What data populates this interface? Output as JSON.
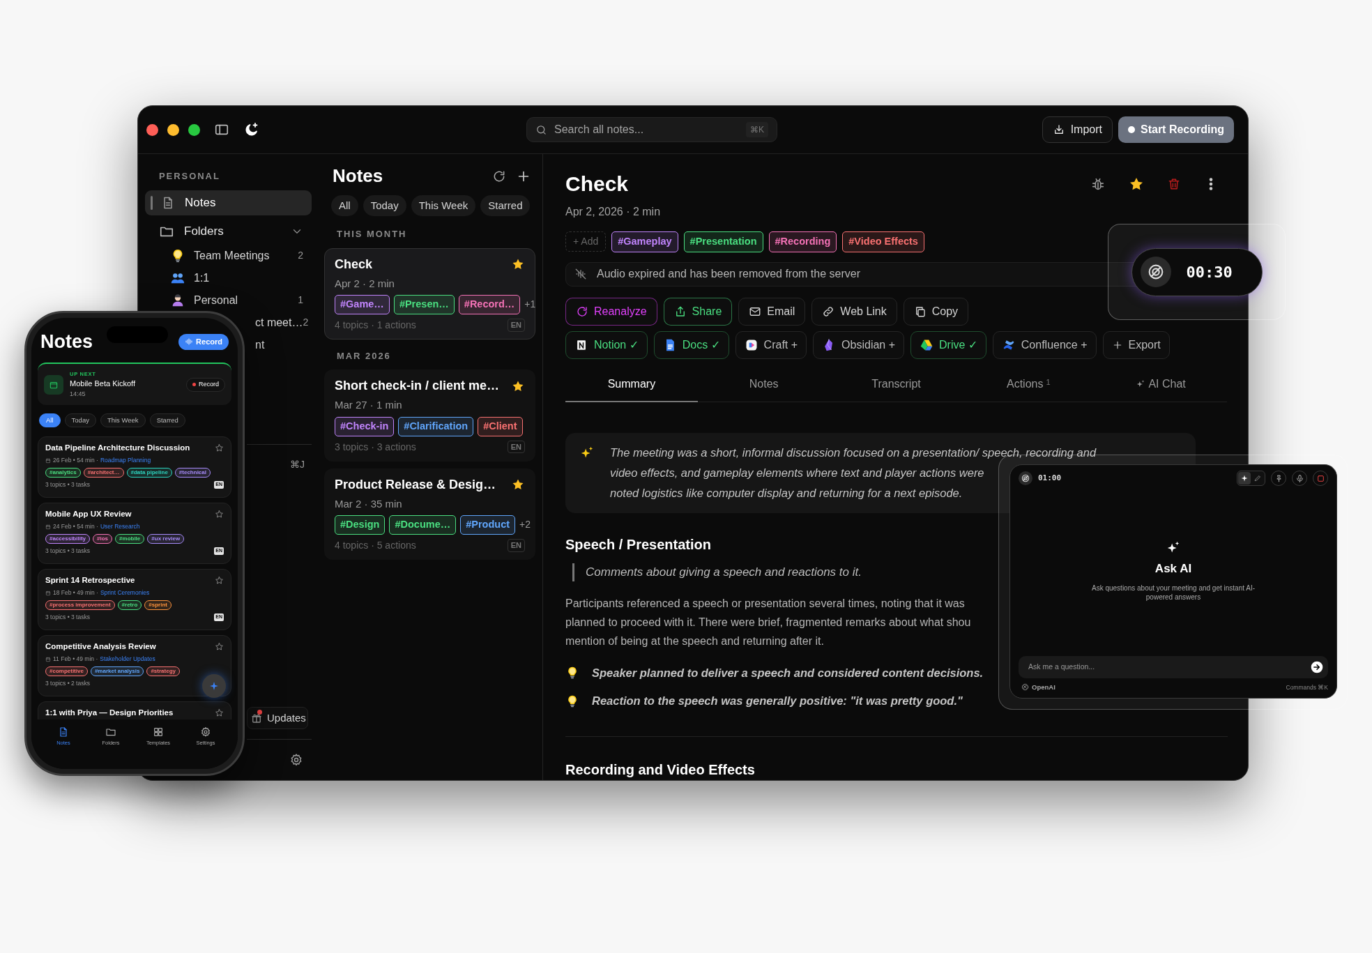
{
  "toolbar": {
    "search": {
      "placeholder": "Search all notes...",
      "shortcut": "⌘K"
    },
    "import_button": "Import",
    "record_button": "Start Recording"
  },
  "sidebar": {
    "section": "PERSONAL",
    "items": [
      {
        "label": "Notes",
        "selected": true
      }
    ],
    "folders": {
      "label": "Folders",
      "expanded": true,
      "children": [
        {
          "label": "Team Meetings",
          "count": "2",
          "kind": "bulb"
        },
        {
          "label": "1:1",
          "kind": "people"
        },
        {
          "label": "Personal",
          "count": "1",
          "kind": "person"
        },
        {
          "label": "ct meet…",
          "count": "2",
          "kind": "partial"
        },
        {
          "label": "nt",
          "kind": "partial"
        }
      ]
    },
    "shortcut": "⌘J",
    "updates_button": "Updates",
    "updates_badge": true
  },
  "notes_list": {
    "title": "Notes",
    "filters": [
      {
        "label": "All",
        "selected": false
      },
      {
        "label": "Today",
        "selected": false
      },
      {
        "label": "This Week",
        "selected": false
      },
      {
        "label": "Starred",
        "selected": false
      }
    ],
    "groups": [
      {
        "heading": "THIS MONTH",
        "notes": [
          {
            "title": "Check",
            "meta": "Apr 2 · 2 min",
            "starred": true,
            "selected": true,
            "tags": [
              {
                "label": "#Game…",
                "color": "#c084fc"
              },
              {
                "label": "#Presen…",
                "color": "#4ade80"
              },
              {
                "label": "#Record…",
                "color": "#f472b6"
              }
            ],
            "more": "+1",
            "footer": "4 topics · 1 actions",
            "lang": "EN"
          }
        ]
      },
      {
        "heading": "MAR 2026",
        "notes": [
          {
            "title": "Short check-in / client me…",
            "meta": "Mar 27 · 1 min",
            "starred": true,
            "selected": false,
            "tags": [
              {
                "label": "#Check-in",
                "color": "#c084fc"
              },
              {
                "label": "#Clarification",
                "color": "#60a5fa"
              },
              {
                "label": "#Client",
                "color": "#f87171"
              }
            ],
            "footer": "3 topics · 3 actions",
            "lang": "EN"
          },
          {
            "title": "Product Release & Desig…",
            "meta": "Mar 2 · 35 min",
            "starred": true,
            "selected": false,
            "tags": [
              {
                "label": "#Design",
                "color": "#4ade80"
              },
              {
                "label": "#Docume…",
                "color": "#4ade80"
              },
              {
                "label": "#Product",
                "color": "#60a5fa"
              }
            ],
            "more": "+2",
            "footer": "4 topics · 5 actions",
            "lang": "EN"
          }
        ]
      }
    ]
  },
  "note": {
    "title": "Check",
    "meta": "Apr 2, 2026 · 2 min",
    "starred": true,
    "add_tag": "+ Add",
    "tags": [
      {
        "label": "#Gameplay",
        "color": "#c084fc"
      },
      {
        "label": "#Presentation",
        "color": "#4ade80"
      },
      {
        "label": "#Recording",
        "color": "#f472b6"
      },
      {
        "label": "#Video Effects",
        "color": "#f87171"
      }
    ],
    "notice": "Audio expired and has been removed from the server",
    "actions": [
      {
        "label": "Reanalyze",
        "kind": "reanalyze",
        "color": "#e040fb"
      },
      {
        "label": "Share",
        "kind": "share",
        "color": "#4ade80"
      },
      {
        "label": "Email",
        "kind": "email",
        "color": "#d4d4d4"
      },
      {
        "label": "Web Link",
        "kind": "link",
        "color": "#d4d4d4"
      },
      {
        "label": "Copy",
        "kind": "copy",
        "color": "#d4d4d4"
      }
    ],
    "integrations": [
      {
        "label": "Notion",
        "kind": "notion",
        "mark": "✓",
        "connected": true
      },
      {
        "label": "Docs",
        "kind": "docs",
        "mark": "✓",
        "connected": true
      },
      {
        "label": "Craft",
        "kind": "craft",
        "mark": "+",
        "connected": false
      },
      {
        "label": "Obsidian",
        "kind": "obsidian",
        "mark": "+",
        "connected": false
      },
      {
        "label": "Drive",
        "kind": "drive",
        "mark": "✓",
        "connected": true
      },
      {
        "label": "Confluence",
        "kind": "confluence",
        "mark": "+",
        "connected": false
      }
    ],
    "export_button": "Export",
    "tabs": [
      {
        "label": "Summary",
        "selected": true,
        "kind": "plain"
      },
      {
        "label": "Notes",
        "selected": false,
        "kind": "plain"
      },
      {
        "label": "Transcript",
        "selected": false,
        "kind": "plain"
      },
      {
        "label": "Actions",
        "count": "1",
        "selected": false,
        "kind": "plain"
      },
      {
        "label": "AI Chat",
        "selected": false,
        "kind": "ai"
      }
    ],
    "overview_lines": [
      "The meeting was a short, informal discussion focused on a presentation/ speech, recording and",
      "video effects, and gameplay elements where text and player actions were",
      "noted logistics like computer display and returning for a next episode."
    ],
    "sections": [
      {
        "heading": "Speech / Presentation",
        "quote": "Comments about giving a speech and reactions to it.",
        "body_lines": [
          "Participants referenced a speech or presentation several times, noting that it was",
          "planned to proceed with it. There were brief, fragmented remarks about what shou",
          "mention of being at the speech and returning after it."
        ],
        "points": [
          "Speaker planned to deliver a speech and considered content decisions.",
          "Reaction to the speech was generally positive: \"it was pretty good.\""
        ]
      },
      {
        "heading": "Recording and Video Effects"
      }
    ]
  },
  "timer": {
    "time": "00:30"
  },
  "ask_ai": {
    "time": "01:00",
    "modes": [
      {
        "kind": "ai",
        "selected": true
      },
      {
        "kind": "pen",
        "selected": false
      }
    ],
    "title": "Ask AI",
    "subtitle": "Ask questions about your meeting and get instant AI-powered answers",
    "input": {
      "placeholder": "Ask me a question..."
    },
    "provider": "OpenAI",
    "shortcut": "Commands ⌘K"
  },
  "phone": {
    "title": "Notes",
    "record_button": "Record",
    "up_next": {
      "label": "UP NEXT",
      "title": "Mobile Beta Kickoff",
      "time": "14:45",
      "button": "Record"
    },
    "filters": [
      {
        "label": "All",
        "selected": true
      },
      {
        "label": "Today",
        "selected": false
      },
      {
        "label": "This Week",
        "selected": false
      },
      {
        "label": "Starred",
        "selected": false
      }
    ],
    "notes": [
      {
        "title": "Data Pipeline Architecture Discussion",
        "meta": "26 Feb • 54 min ·",
        "folder": "Roadmap Planning",
        "starred": false,
        "tags": [
          {
            "label": "#analytics",
            "color": "#4ade80"
          },
          {
            "label": "#architect…",
            "color": "#f87171"
          },
          {
            "label": "#data pipeline",
            "color": "#2dd4bf"
          },
          {
            "label": "#technical",
            "color": "#a78bfa"
          }
        ],
        "footer": "3 topics • 3 tasks",
        "lang": "EN"
      },
      {
        "title": "Mobile App UX Review",
        "meta": "24 Feb • 54 min ·",
        "folder": "User Research",
        "starred": false,
        "tags": [
          {
            "label": "#accessibility",
            "color": "#c084fc"
          },
          {
            "label": "#ios",
            "color": "#f472b6"
          },
          {
            "label": "#mobile",
            "color": "#4ade80"
          },
          {
            "label": "#ux review",
            "color": "#a78bfa"
          }
        ],
        "footer": "3 topics • 3 tasks",
        "lang": "EN"
      },
      {
        "title": "Sprint 14 Retrospective",
        "meta": "18 Feb • 49 min ·",
        "folder": "Sprint Ceremonies",
        "starred": false,
        "tags": [
          {
            "label": "#process improvement",
            "color": "#f87171"
          },
          {
            "label": "#retro",
            "color": "#4ade80"
          },
          {
            "label": "#sprint",
            "color": "#fb923c"
          }
        ],
        "footer": "3 topics • 3 tasks",
        "lang": "EN"
      },
      {
        "title": "Competitive Analysis Review",
        "meta": "11 Feb • 49 min ·",
        "folder": "Stakeholder Updates",
        "starred": false,
        "tags": [
          {
            "label": "#competitive",
            "color": "#f87171"
          },
          {
            "label": "#market analysis",
            "color": "#60a5fa"
          },
          {
            "label": "#strategy",
            "color": "#f87171"
          }
        ],
        "footer": "3 topics • 2 tasks"
      },
      {
        "title": "1:1 with Priya — Design Priorities",
        "starred": false
      }
    ],
    "tabs": [
      {
        "label": "Notes",
        "selected": true,
        "kind": "notes"
      },
      {
        "label": "Folders",
        "selected": false,
        "kind": "folders"
      },
      {
        "label": "Templates",
        "selected": false,
        "kind": "templates"
      },
      {
        "label": "Settings",
        "selected": false,
        "kind": "settings"
      }
    ]
  }
}
